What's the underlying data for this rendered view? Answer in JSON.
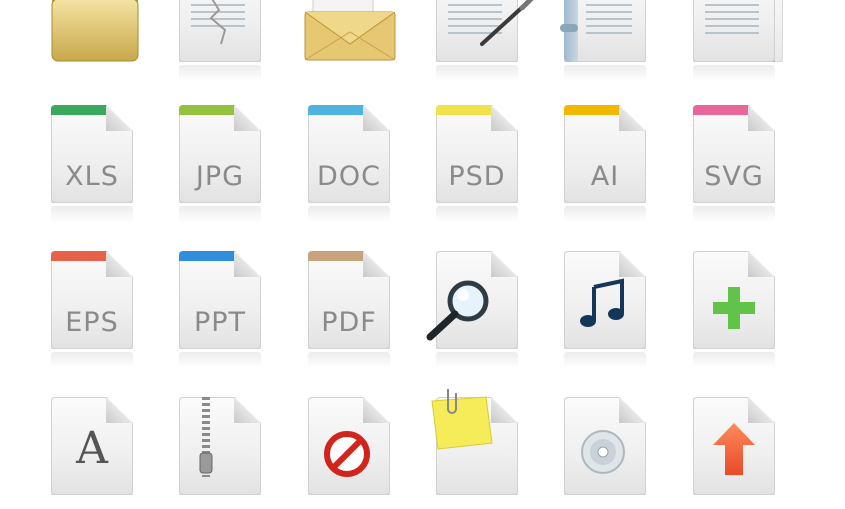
{
  "file_types": {
    "xls": "XLS",
    "jpg": "JPG",
    "doc": "DOC",
    "psd": "PSD",
    "ai": "AI",
    "svg": "SVG",
    "eps": "EPS",
    "ppt": "PPT",
    "pdf": "PDF"
  },
  "font_icon_letter": "A",
  "colors": {
    "xls": "#3aa85e",
    "jpg": "#93c23e",
    "doc": "#4fb3e0",
    "psd": "#f0e24a",
    "ai": "#f0b800",
    "svg": "#e8669a",
    "eps": "#e8604a",
    "ppt": "#2f8fdc",
    "pdf": "#c9a37c"
  },
  "icons": [
    "folder-icon",
    "torn-document-icon",
    "envelope-icon",
    "pen-document-icon",
    "bound-document-icon",
    "stacked-documents-icon",
    "magnifier-icon",
    "music-note-icon",
    "plus-icon",
    "font-letter-icon",
    "zipper-icon",
    "forbidden-icon",
    "sticky-note-icon",
    "disc-icon",
    "upload-arrow-icon"
  ]
}
